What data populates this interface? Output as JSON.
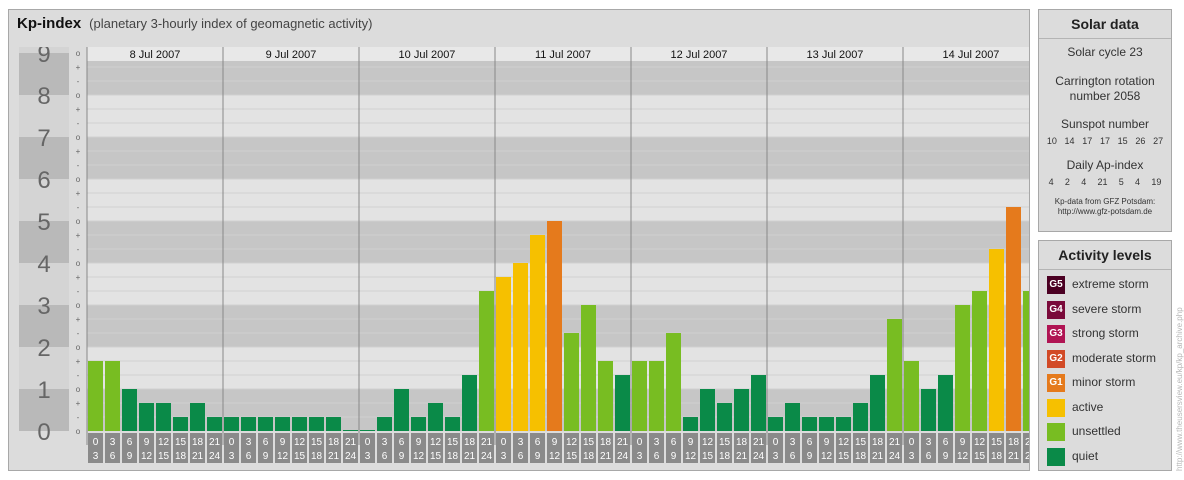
{
  "title": "Kp-index",
  "subtitle": "(planetary 3-hourly index of geomagnetic activity)",
  "chart_data": {
    "type": "bar",
    "ylim": [
      0,
      9
    ],
    "y_ticks": [
      "0",
      "1",
      "2",
      "3",
      "4",
      "5",
      "6",
      "7",
      "8",
      "9"
    ],
    "minor_tick_labels": [
      "o",
      "+",
      "-"
    ],
    "days": [
      "8 Jul 2007",
      "9 Jul 2007",
      "10 Jul 2007",
      "11 Jul 2007",
      "12 Jul 2007",
      "13 Jul 2007",
      "14 Jul 2007"
    ],
    "hour_bins": [
      [
        "0",
        "3"
      ],
      [
        "3",
        "6"
      ],
      [
        "6",
        "9"
      ],
      [
        "9",
        "12"
      ],
      [
        "12",
        "15"
      ],
      [
        "15",
        "18"
      ],
      [
        "18",
        "21"
      ],
      [
        "21",
        "24"
      ]
    ],
    "values": [
      1.667,
      1.667,
      1.0,
      0.667,
      0.667,
      0.333,
      0.667,
      0.333,
      0.333,
      0.333,
      0.333,
      0.333,
      0.333,
      0.333,
      0.333,
      0.0,
      0.0,
      0.333,
      1.0,
      0.333,
      0.667,
      0.333,
      1.333,
      3.333,
      3.667,
      4.0,
      4.667,
      5.0,
      2.333,
      3.0,
      1.667,
      1.333,
      1.667,
      1.667,
      2.333,
      0.333,
      1.0,
      0.667,
      1.0,
      1.333,
      0.333,
      0.667,
      0.333,
      0.333,
      0.333,
      0.667,
      1.333,
      2.667,
      1.667,
      1.0,
      1.333,
      3.0,
      3.333,
      4.333,
      5.333,
      3.333
    ],
    "colors": {
      "quiet": "#0a8a48",
      "unsettled": "#78bd22",
      "active": "#f6c000",
      "minor": "#e57a1c"
    }
  },
  "solar": {
    "title": "Solar data",
    "cycle": "Solar cycle 23",
    "carrington_1": "Carrington rotation",
    "carrington_2": "number 2058",
    "sunspot_title": "Sunspot number",
    "sunspot_values": [
      "10",
      "14",
      "17",
      "17",
      "15",
      "26",
      "27"
    ],
    "ap_title": "Daily Ap-index",
    "ap_values": [
      "4",
      "2",
      "4",
      "21",
      "5",
      "4",
      "19"
    ],
    "credit_1": "Kp-data from GFZ Potsdam:",
    "credit_2": "http://www.gfz-potsdam.de"
  },
  "activity": {
    "title": "Activity levels",
    "levels": [
      {
        "badge": "G5",
        "label": "extreme storm",
        "color": "#4b0022"
      },
      {
        "badge": "G4",
        "label": "severe storm",
        "color": "#7a0a3a"
      },
      {
        "badge": "G3",
        "label": "strong storm",
        "color": "#b01453"
      },
      {
        "badge": "G2",
        "label": "moderate storm",
        "color": "#d24a26"
      },
      {
        "badge": "G1",
        "label": "minor storm",
        "color": "#e57a1c"
      },
      {
        "badge": "",
        "label": "active",
        "color": "#f6c000"
      },
      {
        "badge": "",
        "label": "unsettled",
        "color": "#78bd22"
      },
      {
        "badge": "",
        "label": "quiet",
        "color": "#0a8a48"
      }
    ]
  },
  "watermark": "http://www.theusersview.eu/kp/kp_archive.php"
}
